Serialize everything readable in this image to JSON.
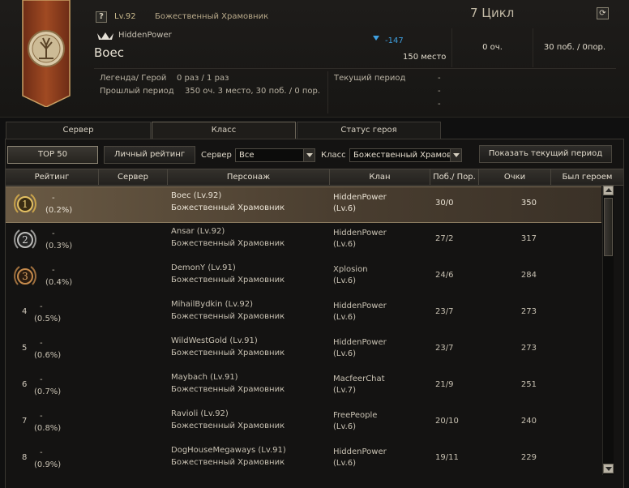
{
  "player": {
    "help_glyph": "?",
    "level": "Lv.92",
    "class": "Божественный Храмовник",
    "guild": "HiddenPower",
    "name": "Boec",
    "rank_change": "-147",
    "rank_place": "150 место",
    "points": "0 оч.",
    "wins_losses": "30 поб. /  0пор.",
    "legend_hero_label": "Легенда/ Герой",
    "legend_hero_value": "0 раз / 1 раз",
    "prev_period_label": "Прошлый период",
    "prev_period_value": "350 оч.  3 место,  30 поб. / 0 пор.",
    "current_period_label": "Текущий период",
    "current_period_values": [
      "-",
      "-",
      "-"
    ]
  },
  "cycle": "7 Цикл",
  "refresh_glyph": "⟳",
  "colors": {
    "accent_blue": "#3fa0e0",
    "selected_row": "#6a5a44",
    "gold": "#c8a24a"
  },
  "tabs": [
    {
      "label": "Сервер"
    },
    {
      "label": "Класс"
    },
    {
      "label": "Статус героя"
    }
  ],
  "filters": {
    "top50": "TOP 50",
    "personal": "Личный рейтинг",
    "server_label": "Сервер",
    "server_value": "Все",
    "class_label": "Класс",
    "class_value": "Божественный Храмовник",
    "show_period": "Показать текущий период"
  },
  "columns": {
    "rating": "Рейтинг",
    "server": "Сервер",
    "character": "Персонаж",
    "clan": "Клан",
    "wl": "Поб./ Пор.",
    "points": "Очки",
    "was_hero": "Был героем"
  },
  "rows": [
    {
      "rank": "1",
      "change": "-",
      "pct": "(0.2%)",
      "name": "Boec (Lv.92)",
      "cls": "Божественный Храмовник",
      "clan": "HiddenPower",
      "clan_lv": "(Lv.6)",
      "wl": "30/0",
      "points": "350"
    },
    {
      "rank": "2",
      "change": "-",
      "pct": "(0.3%)",
      "name": "Ansar (Lv.92)",
      "cls": "Божественный Храмовник",
      "clan": "HiddenPower",
      "clan_lv": "(Lv.6)",
      "wl": "27/2",
      "points": "317"
    },
    {
      "rank": "3",
      "change": "-",
      "pct": "(0.4%)",
      "name": "DemonY (Lv.91)",
      "cls": "Божественный Храмовник",
      "clan": "Xplosion",
      "clan_lv": "(Lv.6)",
      "wl": "24/6",
      "points": "284"
    },
    {
      "rank": "4",
      "change": "-",
      "pct": "(0.5%)",
      "name": "MihailBydkin (Lv.92)",
      "cls": "Божественный Храмовник",
      "clan": "HiddenPower",
      "clan_lv": "(Lv.6)",
      "wl": "23/7",
      "points": "273"
    },
    {
      "rank": "5",
      "change": "-",
      "pct": "(0.6%)",
      "name": "WildWestGold (Lv.91)",
      "cls": "Божественный Храмовник",
      "clan": "HiddenPower",
      "clan_lv": "(Lv.6)",
      "wl": "23/7",
      "points": "273"
    },
    {
      "rank": "6",
      "change": "-",
      "pct": "(0.7%)",
      "name": "Maybach (Lv.91)",
      "cls": "Божественный Храмовник",
      "clan": "MacfeerChat",
      "clan_lv": "(Lv.7)",
      "wl": "21/9",
      "points": "251"
    },
    {
      "rank": "7",
      "change": "-",
      "pct": "(0.8%)",
      "name": "Ravioli (Lv.92)",
      "cls": "Божественный Храмовник",
      "clan": "FreePeople",
      "clan_lv": "(Lv.6)",
      "wl": "20/10",
      "points": "240"
    },
    {
      "rank": "8",
      "change": "-",
      "pct": "(0.9%)",
      "name": "DogHouseMegaways (Lv.91)",
      "cls": "Божественный Храмовник",
      "clan": "HiddenPower",
      "clan_lv": "(Lv.6)",
      "wl": "19/11",
      "points": "229"
    }
  ]
}
